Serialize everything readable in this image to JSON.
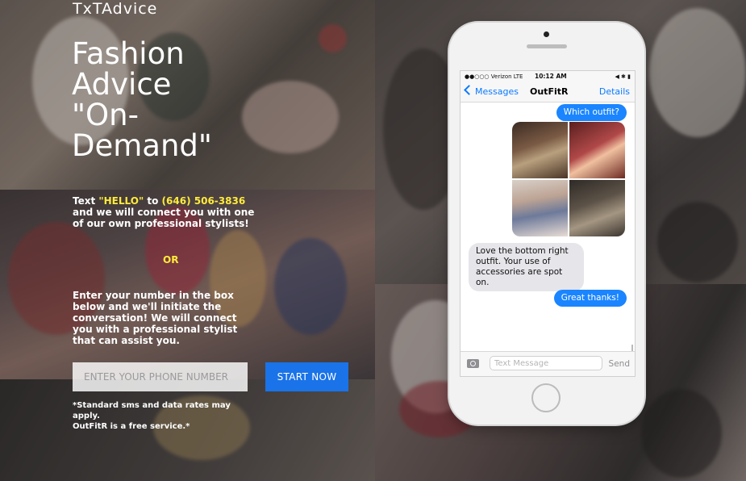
{
  "brand": "TxTAdvice",
  "headline": [
    "Fashion",
    "Advice",
    "\"On-",
    "Demand\""
  ],
  "cta": {
    "text_prefix": "Text ",
    "keyword": "\"HELLO\"",
    "to": " to ",
    "phone_number": "(646) 506-3836",
    "text_suffix": " and we will connect you with one of our own professional stylists!"
  },
  "or_label": "OR",
  "enter_text": "Enter your number in the box below and we'll initiate the conversation! We will connect you with a professional stylist that can assist you.",
  "form": {
    "placeholder": "ENTER YOUR PHONE NUMBER",
    "value": "",
    "button_label": "START NOW"
  },
  "disclaimer": {
    "line1": "*Standard sms and data rates may apply.",
    "line2": "OutFitR is a free service.*"
  },
  "phone_ui": {
    "status_left": "●●○○○ Verizon  LTE",
    "status_time": "10:12 AM",
    "status_right": "◀ ✱ ▮",
    "nav_back": "Messages",
    "nav_title": "OutFitR",
    "nav_details": "Details",
    "messages": [
      {
        "direction": "out",
        "text": "Which outfit?"
      },
      {
        "direction": "in",
        "text": "Love the bottom right outfit. Your use of accessories are spot on."
      },
      {
        "direction": "out",
        "text": "Great thanks!"
      }
    ],
    "input_placeholder": "Text Message",
    "send_label": "Send"
  },
  "colors": {
    "accent": "#1a73e8",
    "highlight": "#ffeb3b",
    "bubble_out": "#1a85ff",
    "bubble_in": "#e5e5ea"
  }
}
